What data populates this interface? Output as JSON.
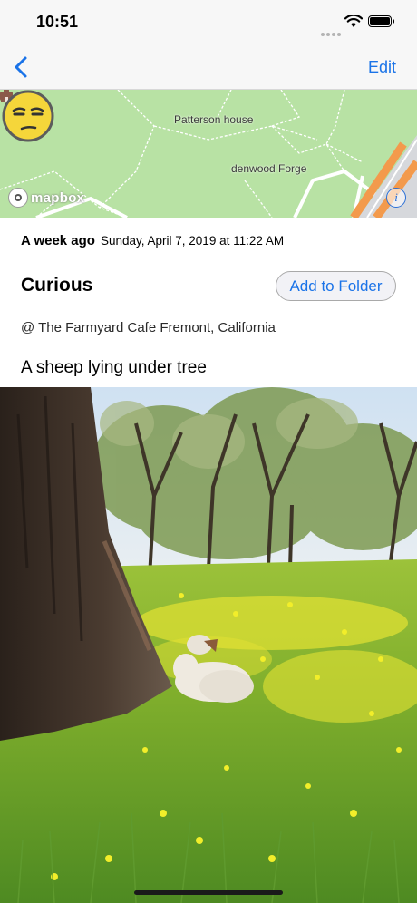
{
  "status_bar": {
    "time": "10:51"
  },
  "nav": {
    "back_icon": "chevron-left-icon",
    "edit_label": "Edit",
    "accent_color": "#1a73e8"
  },
  "map": {
    "labels": [
      "Patterson house",
      "denwood Forge"
    ],
    "attribution": "mapbox",
    "info_icon": "info-icon",
    "pin_icon": "unamused-face-icon"
  },
  "entry": {
    "relative_time": "A week ago",
    "absolute_time": "Sunday, April 7, 2019 at 11:22 AM",
    "mood": "Curious",
    "add_to_folder_label": "Add to Folder",
    "location": "@ The Farmyard Cafe Fremont, California",
    "caption": "A sheep lying under tree"
  },
  "photo": {
    "subject": "sheep-under-tree-photo"
  }
}
